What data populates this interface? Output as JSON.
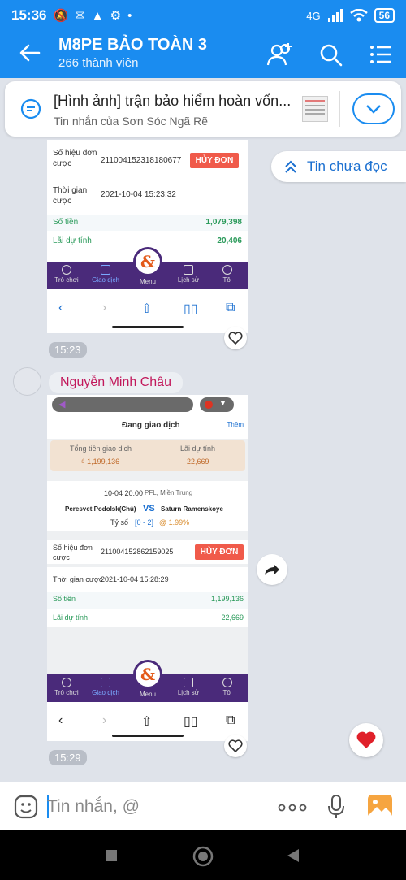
{
  "status": {
    "time": "15:36",
    "network": "4G",
    "battery": "56"
  },
  "header": {
    "title": "M8PE BẢO TOÀN 3",
    "members": "266 thành viên"
  },
  "pinned": {
    "title": "[Hình ảnh] trận bảo hiểm hoàn vốn...",
    "subtitle": "Tin nhắn của Sơn Sóc  Ngã Rẽ"
  },
  "unread_label": "Tin chưa đọc",
  "msg1": {
    "order_label": "Số hiệu đơn cược",
    "order_id": "211004152318180677",
    "cancel": "HỦY ĐƠN",
    "time_label": "Thời gian cược",
    "time_value": "2021-10-04 15:23:32",
    "amount_label": "Số tiền",
    "amount": "1,079,398",
    "profit_label": "Lãi dự tính",
    "profit": "20,406",
    "nav": [
      "Trò chơi",
      "Giao dịch",
      "Menu",
      "Lịch sử",
      "Tôi"
    ],
    "timestamp": "15:23"
  },
  "msg2": {
    "sender": "Nguyễn Minh Châu",
    "panel_title": "Đang giao dịch",
    "more": "Thêm",
    "total_label": "Tổng tiền giao dịch",
    "total_value": "₫ 1,199,136",
    "profit_label": "Lãi dự tính",
    "profit_value": "22,669",
    "match_time": "10-04 20:00",
    "league": "PFL, Miền Trung",
    "home": "Peresvet Podolsk(Chủ)",
    "vs": "VS",
    "away": "Saturn Ramenskoye",
    "score_label": "Tỷ số",
    "score": "[0 - 2]",
    "odds": "@ 1.99%",
    "order_label": "Số hiệu đơn cược",
    "order_id": "211004152862159025",
    "cancel": "HỦY ĐƠN",
    "time_label": "Thời gian cược",
    "time_value": "2021-10-04 15:28:29",
    "amount_label": "Số tiền",
    "amount": "1,199,136",
    "profit2_label": "Lãi dự tính",
    "profit2": "22,669",
    "nav": [
      "Trò chơi",
      "Giao dịch",
      "Menu",
      "Lịch sử",
      "Tôi"
    ],
    "timestamp": "15:29"
  },
  "input": {
    "placeholder": "Tin nhắn, @"
  },
  "colors": {
    "brand": "#1a8cf0",
    "danger": "#f05a4a",
    "nav": "#4a2a7a"
  }
}
